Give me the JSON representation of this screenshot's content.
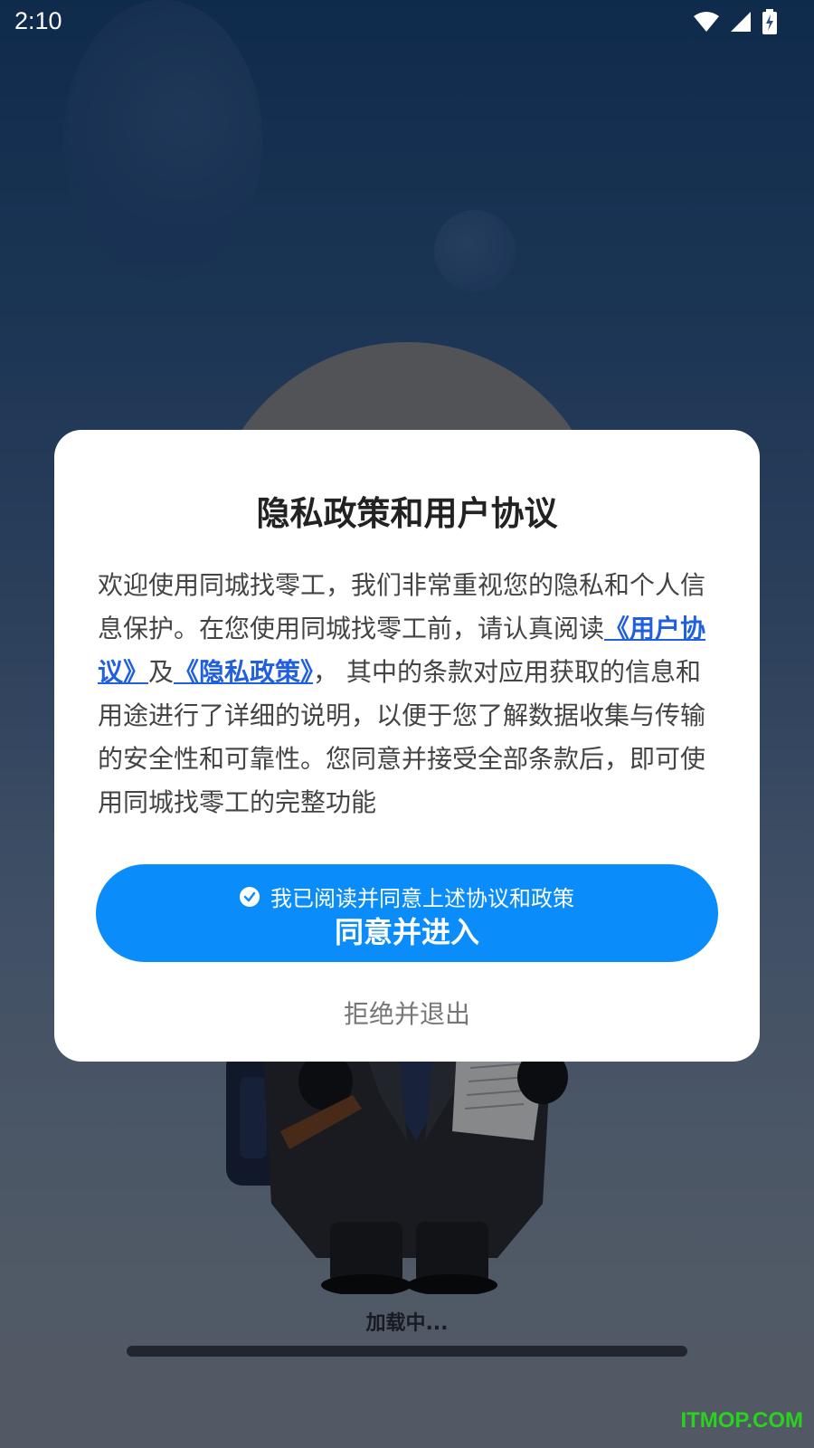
{
  "status_bar": {
    "time": "2:10"
  },
  "dialog": {
    "title": "隐私政策和用户协议",
    "body_prefix": "欢迎使用同城找零工，我们非常重视您的隐私和个人信息保护。在您使用同城找零工前，请认真阅读",
    "user_agreement_link": "《用户协议》",
    "conjunction": "及",
    "privacy_policy_link": "《隐私政策》",
    "body_suffix": "， 其中的条款对应用获取的信息和用途进行了详细的说明，以便于您了解数据收集与传输的安全性和可靠性。您同意并接受全部条款后，即可使用同城找零工的完整功能",
    "agree_checkbox_label": "我已阅读并同意上述协议和政策",
    "agree_button_label": "同意并进入",
    "reject_button_label": "拒绝并退出"
  },
  "loading": {
    "text": "加载中..."
  },
  "watermark": "ITMOP.COM",
  "colors": {
    "primary": "#0a8cfb",
    "link": "#1f5fe0",
    "watermark": "#2bd11f"
  },
  "icons": {
    "wifi": "wifi-icon",
    "signal": "signal-icon",
    "battery": "battery-charging-icon",
    "check": "check-circle-icon"
  }
}
